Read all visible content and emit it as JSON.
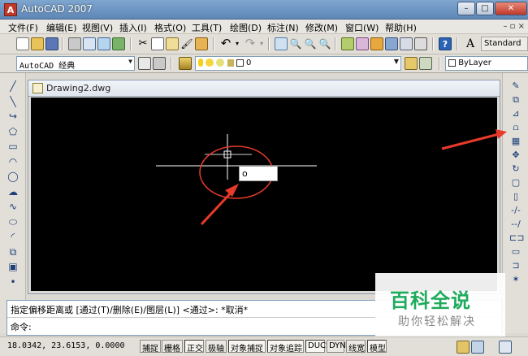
{
  "window": {
    "title": "AutoCAD 2007",
    "app_icon_glyph": "A",
    "minimize": "–",
    "maximize": "□",
    "close": "✕"
  },
  "menu": [
    "文件(F)",
    "编辑(E)",
    "视图(V)",
    "插入(I)",
    "格式(O)",
    "工具(T)",
    "绘图(D)",
    "标注(N)",
    "修改(M)",
    "窗口(W)",
    "帮助(H)"
  ],
  "menu_min_label": "– ▫ ×",
  "toolbar": {
    "text_style": "Standard",
    "text_style_icon": "A",
    "workspace": "AutoCAD 经典",
    "layer": "0",
    "bylayer": "ByLayer"
  },
  "document": {
    "title": "Drawing2.dwg"
  },
  "canvas": {
    "dynamic_input_value": "o"
  },
  "command": {
    "history": "指定偏移距离或 [通过(T)/删除(E)/图层(L)] <通过>:  *取消*",
    "prompt": "命令:"
  },
  "status": {
    "coords": "18.0342, 23.6153, 0.0000",
    "buttons": [
      {
        "label": "捕捉",
        "on": false
      },
      {
        "label": "栅格",
        "on": false
      },
      {
        "label": "正交",
        "on": true
      },
      {
        "label": "极轴",
        "on": false
      },
      {
        "label": "对象捕捉",
        "on": true
      },
      {
        "label": "对象追踪",
        "on": true
      },
      {
        "label": "DUCS",
        "on": true
      },
      {
        "label": "DYN",
        "on": false
      },
      {
        "label": "线宽",
        "on": false
      },
      {
        "label": "模型",
        "on": true
      }
    ]
  },
  "watermark": {
    "title": "百科全说",
    "subtitle": "助你轻松解决"
  },
  "colors": {
    "annotation": "#e83a2b",
    "canvas": "#000000",
    "watermark": "#1fab5c"
  },
  "left_tools": [
    "line-icon",
    "construction-line-icon",
    "polyline-icon",
    "polygon-icon",
    "rectangle-icon",
    "arc-icon",
    "circle-icon",
    "revision-cloud-icon",
    "spline-icon",
    "ellipse-icon",
    "ellipse-arc-icon",
    "insert-block-icon",
    "make-block-icon",
    "point-icon"
  ],
  "right_tools": [
    "erase-icon",
    "copy-icon",
    "mirror-icon",
    "offset-icon",
    "array-icon",
    "move-icon",
    "rotate-icon",
    "scale-icon",
    "stretch-icon",
    "trim-icon",
    "extend-icon",
    "break-icon",
    "chamfer-icon",
    "fillet-icon",
    "explode-icon"
  ]
}
